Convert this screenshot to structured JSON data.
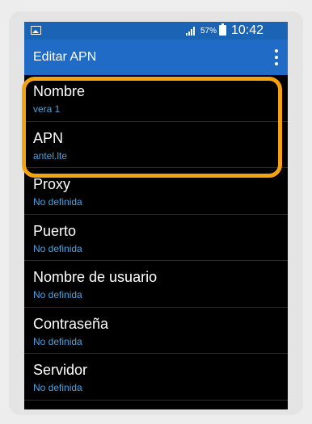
{
  "statusbar": {
    "battery_pct": "57%",
    "time": "10:42",
    "icons": [
      "image-icon",
      "signal-icon",
      "battery-icon"
    ]
  },
  "appbar": {
    "title": "Editar APN",
    "menu_icon": "overflow-menu-icon"
  },
  "items": [
    {
      "label": "Nombre",
      "value": "vera 1"
    },
    {
      "label": "APN",
      "value": "antel.lte"
    },
    {
      "label": "Proxy",
      "value": "No definida"
    },
    {
      "label": "Puerto",
      "value": "No definida"
    },
    {
      "label": "Nombre de usuario",
      "value": "No definida"
    },
    {
      "label": "Contraseña",
      "value": "No definida"
    },
    {
      "label": "Servidor",
      "value": "No definida"
    }
  ],
  "colors": {
    "statusbar_bg": "#1b63b5",
    "appbar_bg": "#1f6bc6",
    "value_text": "#4aa3e0",
    "highlight": "#f2a30f",
    "list_bg": "#000000"
  }
}
